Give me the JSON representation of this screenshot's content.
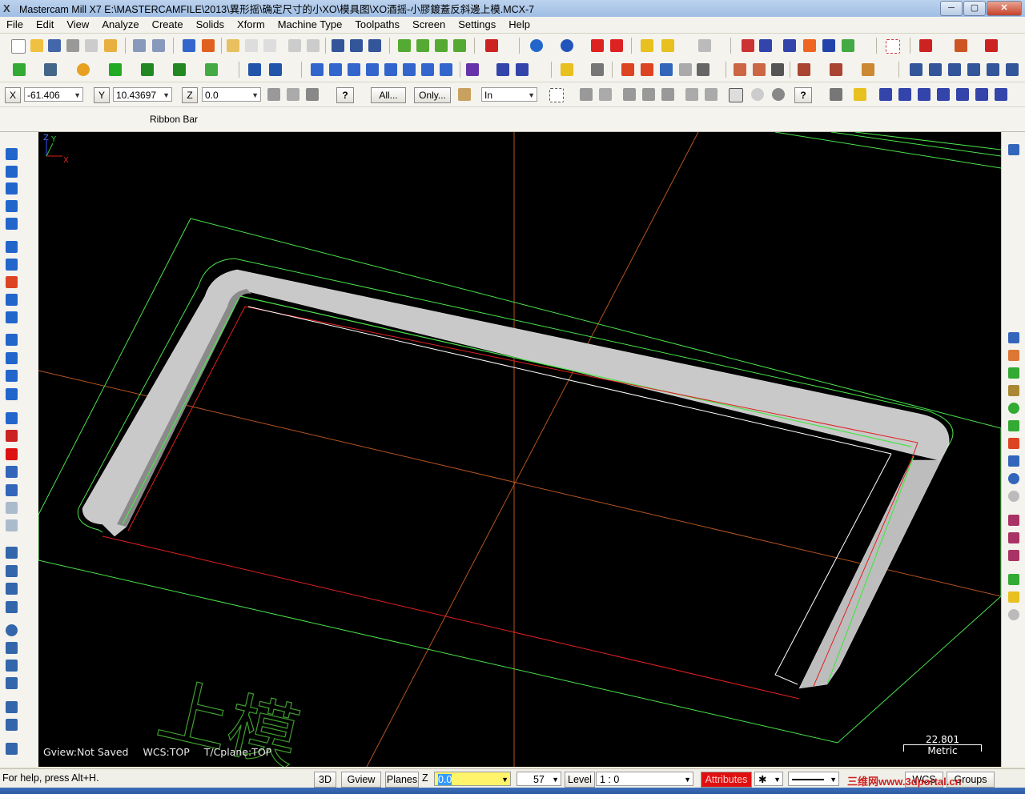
{
  "window": {
    "title": "Mastercam Mill X7  E:\\MASTERCAMFILE\\2013\\異形摇\\确定尺寸的小XO\\模具图\\XO酒摇-小膠鍍蓋反斜邊上模.MCX-7",
    "app_icon": "X",
    "minimize_label": "─",
    "maximize_label": "▢",
    "close_label": "✕"
  },
  "menu": [
    "File",
    "Edit",
    "View",
    "Analyze",
    "Create",
    "Solids",
    "Xform",
    "Machine Type",
    "Toolpaths",
    "Screen",
    "Settings",
    "Help"
  ],
  "coords": {
    "x_label": "X",
    "x_value": "-61.406",
    "y_label": "Y",
    "y_value": "10.43697",
    "z_label": "Z",
    "z_value": "0.0",
    "all_button": "All...",
    "only_button": "Only...",
    "mode_value": "In",
    "help_button": "?"
  },
  "ribbon": {
    "label": "Ribbon Bar"
  },
  "viewport": {
    "gview": "Gview:Not Saved",
    "wcs": "WCS:TOP",
    "tcplane": "T/Cplane:TOP",
    "scale_value": "22.801",
    "scale_unit": "Metric",
    "watermark_text": "上模",
    "axis_x": "X",
    "axis_y": "Y",
    "axis_z": "Z"
  },
  "status": {
    "help_text": "For help, press Alt+H.",
    "btn_3d": "3D",
    "btn_gview": "Gview",
    "btn_planes": "Planes",
    "z_label": "Z",
    "z_value": "0.0",
    "color_value": "57",
    "level_label": "Level",
    "level_value": "1 : 0",
    "attributes_label": "Attributes",
    "wcs_label": "WCS",
    "groups_label": "Groups",
    "watermark": "三维网www.3dportal.cn"
  },
  "colors": {
    "geometry_green": "#4be24b",
    "chain_red": "#e02020",
    "axis_orange": "#b5541f",
    "viewport_bg": "#000000",
    "attributes_red": "#e01010",
    "z_field_yellow": "#fff46a"
  }
}
